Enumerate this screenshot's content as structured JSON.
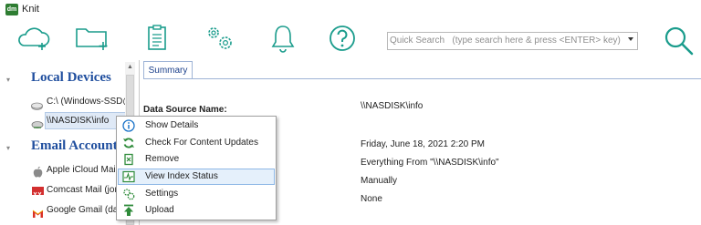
{
  "app": {
    "title": "Knit",
    "logo_text": "dm"
  },
  "toolbar": {
    "icons": [
      "cloud-add-icon",
      "folder-add-icon",
      "clipboard-icon",
      "settings-gears-icon",
      "bell-icon",
      "help-icon",
      "search-icon"
    ],
    "search_placeholder": "Quick Search   (type search here & press <ENTER> key)"
  },
  "sidebar": {
    "local_devices": {
      "title": "Local Devices",
      "items": [
        {
          "label": "C:\\ (Windows-SSD@",
          "icon": "drive-icon"
        },
        {
          "label": "\\\\NASDISK\\info",
          "icon": "network-drive-icon"
        }
      ]
    },
    "email_accounts": {
      "title": "Email Accounts",
      "items": [
        {
          "label": "Apple iCloud Mail (j",
          "icon": "apple-icon"
        },
        {
          "label": "Comcast Mail (jona",
          "icon": "comcast-icon"
        },
        {
          "label": "Google Gmail (data",
          "icon": "gmail-icon"
        }
      ]
    }
  },
  "detail": {
    "tab": "Summary",
    "data_source_label": "Data Source Name:",
    "values": [
      "\\\\NASDISK\\info",
      "Friday, June 18, 2021 2:20 PM",
      "Everything From \"\\\\NASDISK\\info\"",
      "Manually",
      "None"
    ]
  },
  "context_menu": {
    "items": [
      {
        "label": "Show Details",
        "icon": "info-icon"
      },
      {
        "label": "Check For Content Updates",
        "icon": "refresh-icon"
      },
      {
        "label": "Remove",
        "icon": "remove-icon"
      },
      {
        "label": "View Index Status",
        "icon": "index-status-icon",
        "highlighted": true
      },
      {
        "label": "Settings",
        "icon": "settings-icon"
      },
      {
        "label": "Upload",
        "icon": "upload-icon"
      }
    ]
  },
  "colors": {
    "accent": "#1f4e9e",
    "toolbar_icon": "#1a9c8c",
    "menu_highlight": "#e5f0fb"
  }
}
